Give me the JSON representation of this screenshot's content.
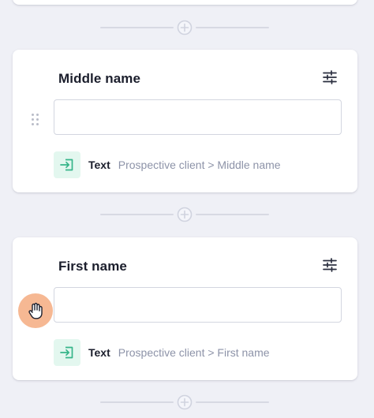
{
  "colors": {
    "page_bg": "#eff0f6",
    "card_bg": "#ffffff",
    "map_icon_bg": "#e3f7ef",
    "map_icon_accent": "#37b58a",
    "muted_text": "#8d93a8",
    "cursor_halo": "#f6b893"
  },
  "fields": [
    {
      "title": "Middle name",
      "value": "",
      "mapping": {
        "icon": "import-icon",
        "type": "Text",
        "path": "Prospective client > Middle name"
      }
    },
    {
      "title": "First name",
      "value": "",
      "mapping": {
        "icon": "import-icon",
        "type": "Text",
        "path": "Prospective client > First name"
      }
    }
  ],
  "icons": {
    "settings": "sliders-icon",
    "drag": "drag-handle-icon",
    "add": "plus-circle-icon",
    "cursor": "hand-cursor-icon"
  }
}
